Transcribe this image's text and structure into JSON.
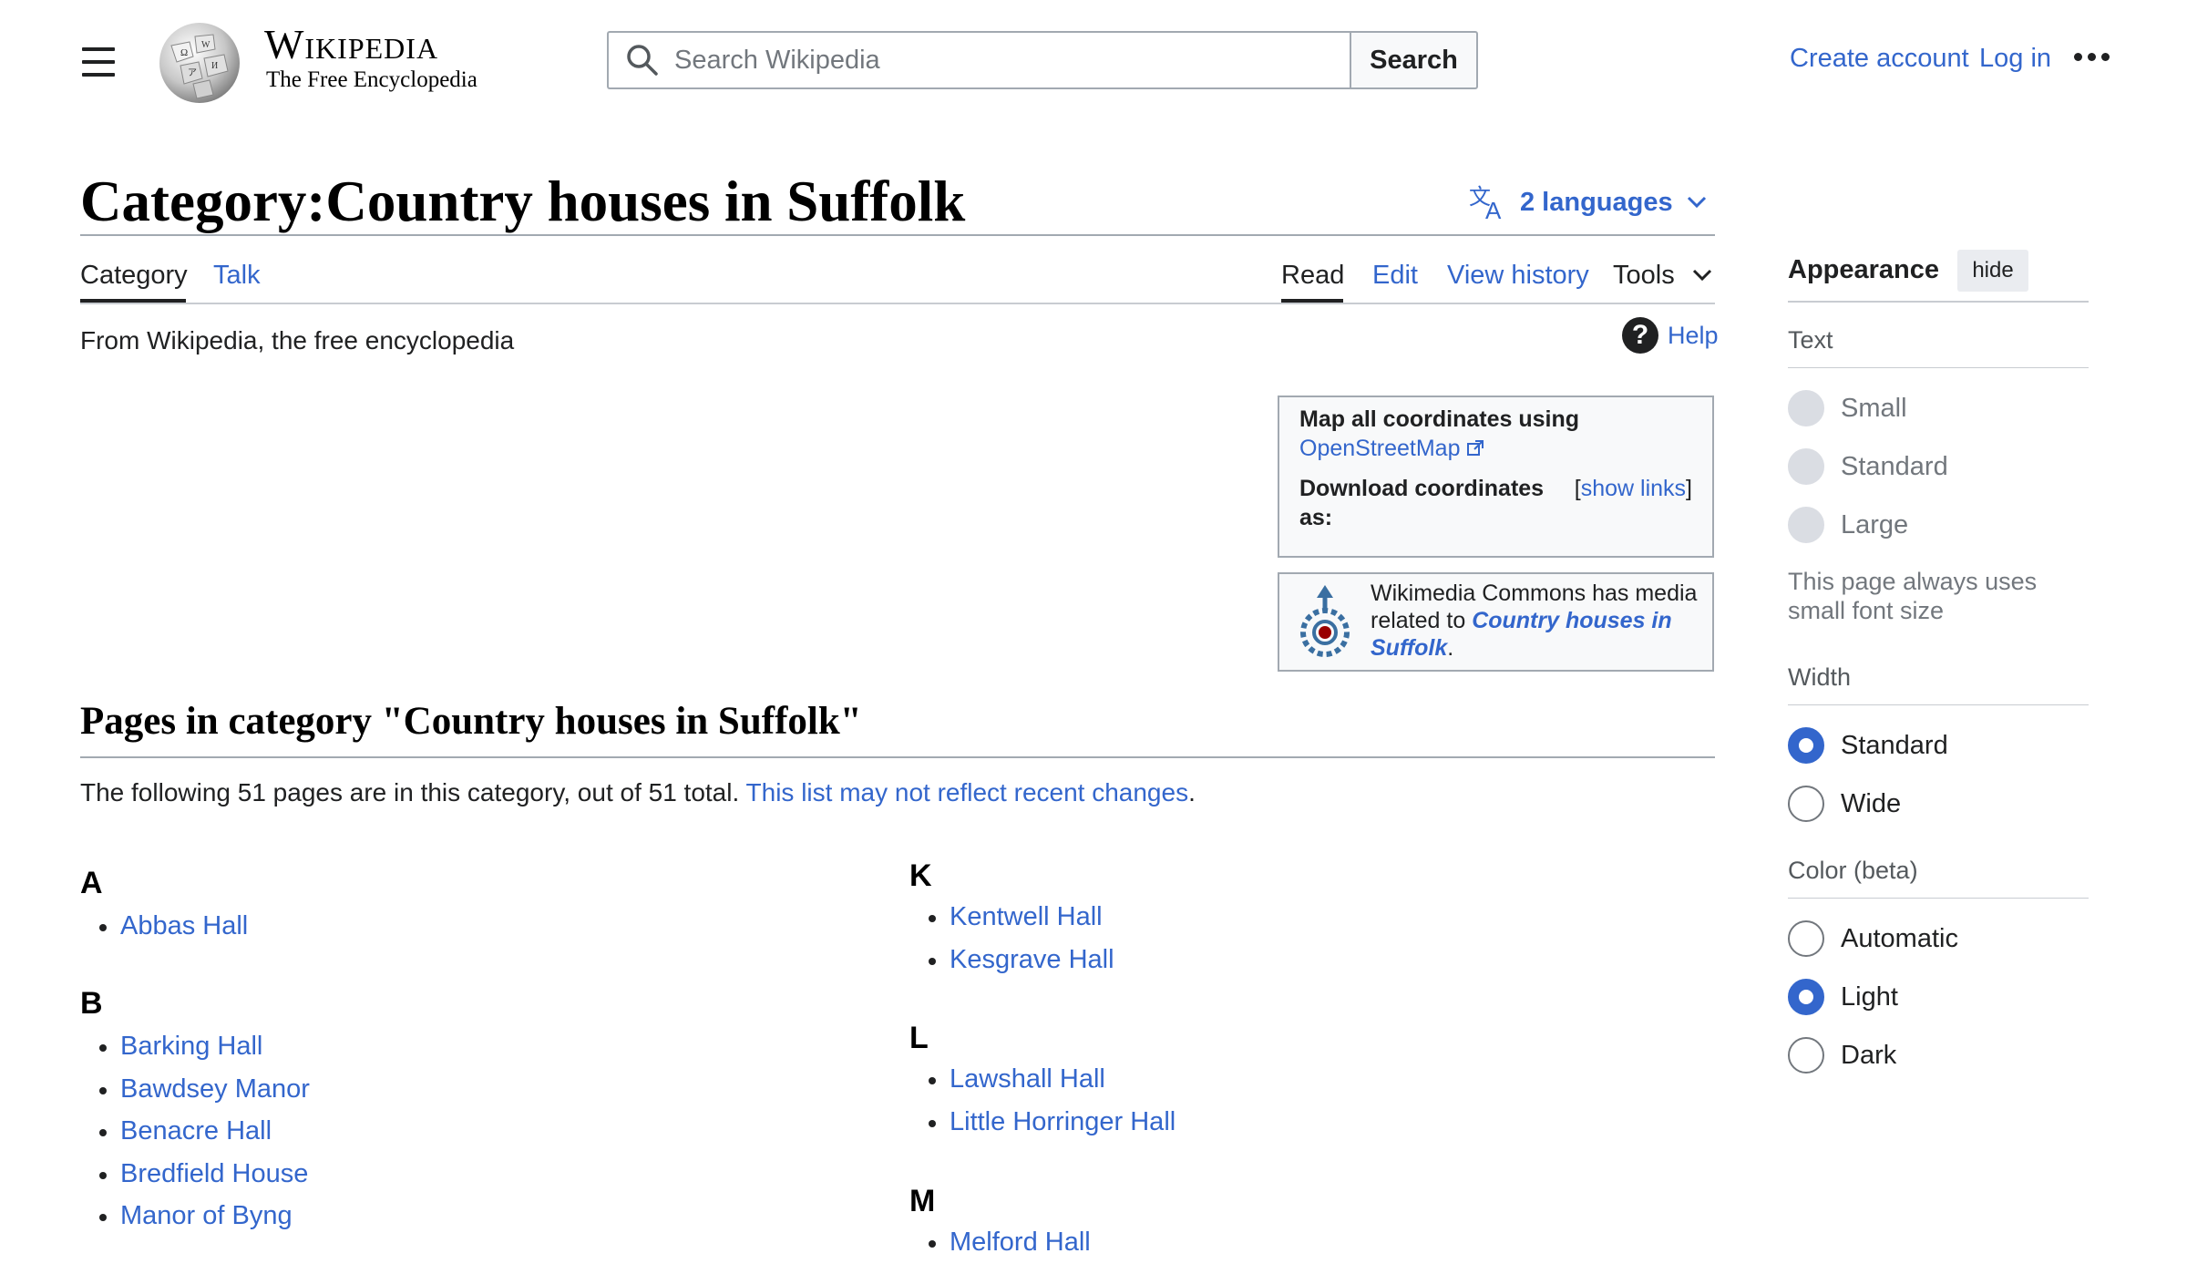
{
  "header": {
    "wordmark_title": "Wikipedia",
    "wordmark_tagline": "The Free Encyclopedia",
    "search_placeholder": "Search Wikipedia",
    "search_button": "Search",
    "create_account": "Create account",
    "log_in": "Log in"
  },
  "page": {
    "title": "Category:Country houses in Suffolk",
    "languages": "2 languages",
    "tabs": {
      "category": "Category",
      "talk": "Talk",
      "read": "Read",
      "edit": "Edit",
      "view_history": "View history",
      "tools": "Tools"
    },
    "tagline": "From Wikipedia, the free encyclopedia",
    "help": "Help",
    "help_glyph": "?"
  },
  "coordinates_box": {
    "map_label": "Map all coordinates using",
    "map_link": "OpenStreetMap",
    "download_label": "Download coordinates as:",
    "bracket_open": "[",
    "show_links": "show links",
    "bracket_close": "]"
  },
  "commons_box": {
    "text_before": "Wikimedia Commons has media related to ",
    "link": "Country houses in Suffolk",
    "text_after": "."
  },
  "category_section": {
    "heading": "Pages in category \"Country houses in Suffolk\"",
    "description": "The following 51 pages are in this category, out of 51 total. ",
    "changes_link": "This list may not reflect recent changes",
    "period": ".",
    "groups": [
      {
        "letter": "A",
        "items": [
          "Abbas Hall"
        ]
      },
      {
        "letter": "B",
        "items": [
          "Barking Hall",
          "Bawdsey Manor",
          "Benacre Hall",
          "Bredfield House",
          "Manor of Byng"
        ]
      },
      {
        "letter": "K",
        "items": [
          "Kentwell Hall",
          "Kesgrave Hall"
        ]
      },
      {
        "letter": "L",
        "items": [
          "Lawshall Hall",
          "Little Horringer Hall"
        ]
      },
      {
        "letter": "M",
        "items": [
          "Melford Hall"
        ]
      }
    ]
  },
  "appearance": {
    "title": "Appearance",
    "hide": "hide",
    "text_label": "Text",
    "text_options": [
      "Small",
      "Standard",
      "Large"
    ],
    "font_note": "This page always uses small font size",
    "width_label": "Width",
    "width_options": [
      "Standard",
      "Wide"
    ],
    "width_selected": "Standard",
    "color_label": "Color (beta)",
    "color_options": [
      "Automatic",
      "Light",
      "Dark"
    ],
    "color_selected": "Light"
  },
  "colors": {
    "link": "#3366cc",
    "text": "#202122",
    "border": "#a2a9b1"
  }
}
